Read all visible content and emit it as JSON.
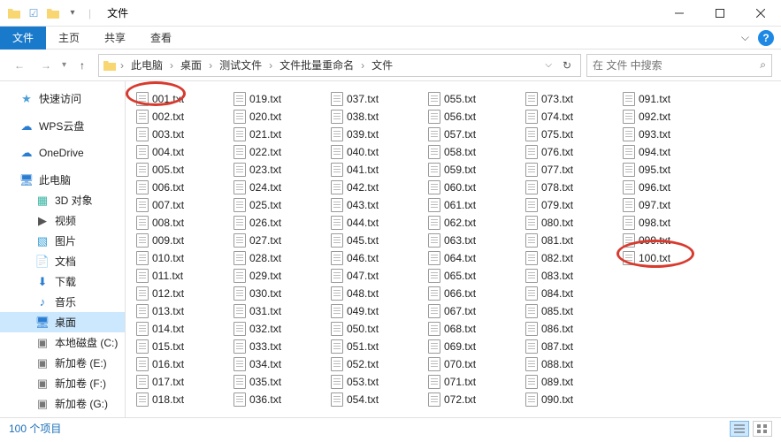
{
  "window": {
    "title": "文件",
    "sep": "|"
  },
  "ribbon": {
    "file": "文件",
    "tabs": [
      "主页",
      "共享",
      "查看"
    ],
    "help": "?"
  },
  "nav": {
    "back": "←",
    "forward": "→",
    "up": "↑",
    "crumbs": [
      "此电脑",
      "桌面",
      "测试文件",
      "文件批量重命名",
      "文件"
    ],
    "refresh": "↻"
  },
  "search": {
    "placeholder": "在 文件 中搜索"
  },
  "sidebar": {
    "quick": "快速访问",
    "wps": "WPS云盘",
    "onedrive": "OneDrive",
    "thispc": "此电脑",
    "items": [
      {
        "icon": "cube",
        "label": "3D 对象"
      },
      {
        "icon": "video",
        "label": "视频"
      },
      {
        "icon": "image",
        "label": "图片"
      },
      {
        "icon": "doc",
        "label": "文档"
      },
      {
        "icon": "download",
        "label": "下载"
      },
      {
        "icon": "music",
        "label": "音乐"
      },
      {
        "icon": "desktop",
        "label": "桌面"
      },
      {
        "icon": "drive",
        "label": "本地磁盘 (C:)"
      },
      {
        "icon": "drive",
        "label": "新加卷 (E:)"
      },
      {
        "icon": "drive",
        "label": "新加卷 (F:)"
      },
      {
        "icon": "drive",
        "label": "新加卷 (G:)"
      }
    ]
  },
  "files": [
    "001.txt",
    "002.txt",
    "003.txt",
    "004.txt",
    "005.txt",
    "006.txt",
    "007.txt",
    "008.txt",
    "009.txt",
    "010.txt",
    "011.txt",
    "012.txt",
    "013.txt",
    "014.txt",
    "015.txt",
    "016.txt",
    "017.txt",
    "018.txt",
    "019.txt",
    "020.txt",
    "021.txt",
    "022.txt",
    "023.txt",
    "024.txt",
    "025.txt",
    "026.txt",
    "027.txt",
    "028.txt",
    "029.txt",
    "030.txt",
    "031.txt",
    "032.txt",
    "033.txt",
    "034.txt",
    "035.txt",
    "036.txt",
    "037.txt",
    "038.txt",
    "039.txt",
    "040.txt",
    "041.txt",
    "042.txt",
    "043.txt",
    "044.txt",
    "045.txt",
    "046.txt",
    "047.txt",
    "048.txt",
    "049.txt",
    "050.txt",
    "051.txt",
    "052.txt",
    "053.txt",
    "054.txt",
    "055.txt",
    "056.txt",
    "057.txt",
    "058.txt",
    "059.txt",
    "060.txt",
    "061.txt",
    "062.txt",
    "063.txt",
    "064.txt",
    "065.txt",
    "066.txt",
    "067.txt",
    "068.txt",
    "069.txt",
    "070.txt",
    "071.txt",
    "072.txt",
    "073.txt",
    "074.txt",
    "075.txt",
    "076.txt",
    "077.txt",
    "078.txt",
    "079.txt",
    "080.txt",
    "081.txt",
    "082.txt",
    "083.txt",
    "084.txt",
    "085.txt",
    "086.txt",
    "087.txt",
    "088.txt",
    "089.txt",
    "090.txt",
    "091.txt",
    "092.txt",
    "093.txt",
    "094.txt",
    "095.txt",
    "096.txt",
    "097.txt",
    "098.txt",
    "099.txt",
    "100.txt"
  ],
  "status": {
    "count": "100 个项目"
  }
}
